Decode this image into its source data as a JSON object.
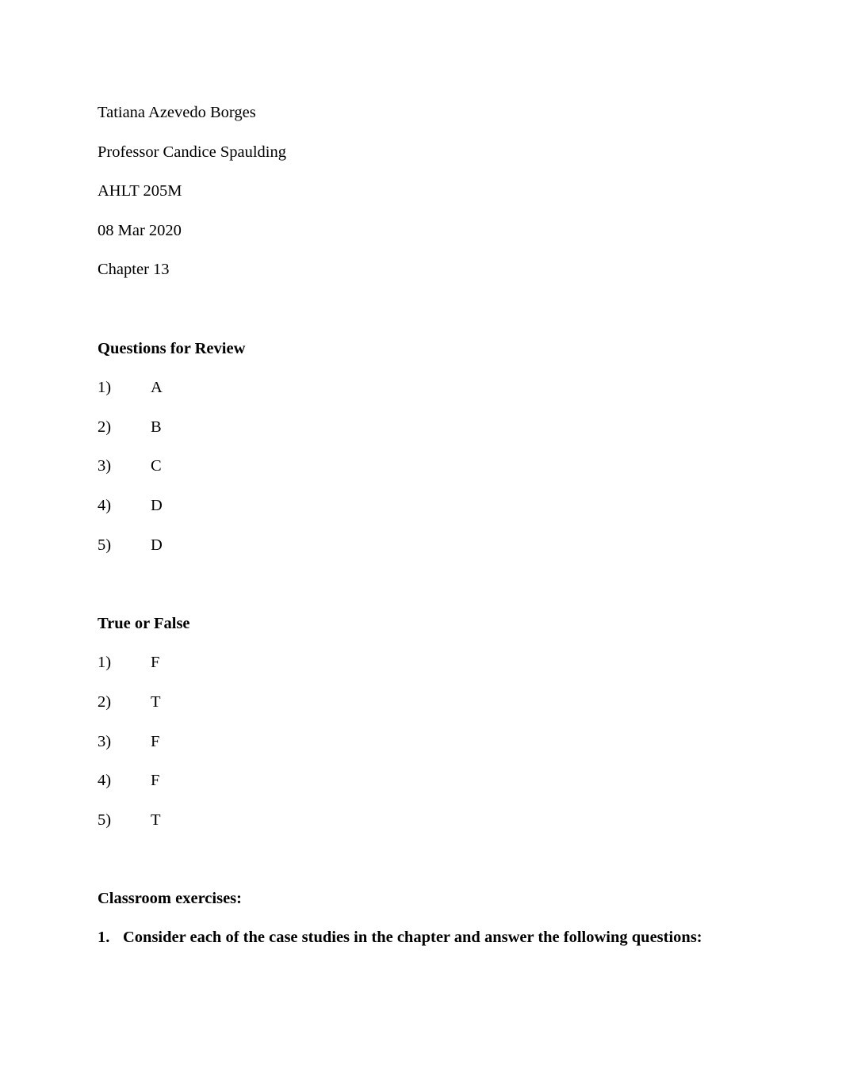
{
  "document": {
    "header_lines": [
      "Tatiana Azevedo Borges",
      "Professor Candice Spaulding",
      "AHLT 205M",
      "08 Mar 2020",
      "Chapter 13"
    ],
    "sections": [
      {
        "heading": "Questions for Review",
        "items": [
          {
            "number": "1)",
            "answer": "A"
          },
          {
            "number": "2)",
            "answer": "B"
          },
          {
            "number": "3)",
            "answer": "C"
          },
          {
            "number": "4)",
            "answer": "D"
          },
          {
            "number": "5)",
            "answer": "D"
          }
        ]
      },
      {
        "heading": "True or False",
        "items": [
          {
            "number": "1)",
            "answer": "F"
          },
          {
            "number": "2)",
            "answer": "T"
          },
          {
            "number": "3)",
            "answer": "F"
          },
          {
            "number": "4)",
            "answer": "F"
          },
          {
            "number": "5)",
            "answer": "T"
          }
        ]
      }
    ],
    "classroom": {
      "heading": "Classroom exercises:",
      "items": [
        {
          "number": "1.",
          "text": "Consider each of the case studies in the chapter and answer the following questions:"
        }
      ]
    }
  }
}
